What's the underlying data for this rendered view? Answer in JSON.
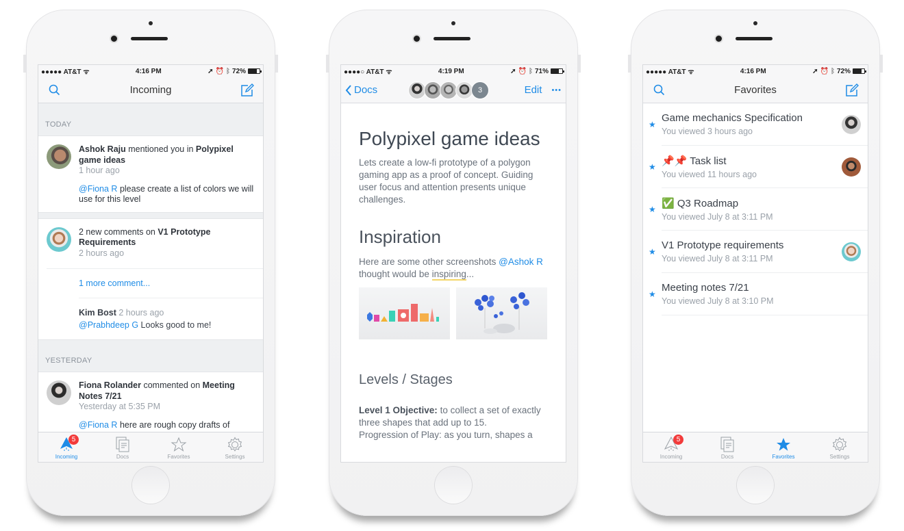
{
  "phones": [
    {
      "status": {
        "carrier": "●●●●● AT&T",
        "time": "4:16 PM",
        "battery": "72%",
        "battery_level": 0.72
      },
      "nav": {
        "title": "Incoming",
        "left_icon": "search-icon",
        "right_icon": "compose-icon"
      },
      "sections": [
        {
          "label": "TODAY"
        },
        {
          "label": "YESTERDAY"
        }
      ],
      "notifications": [
        {
          "actor": "Ashok Raju",
          "verb": " mentioned you in ",
          "doc": "Polypixel game ideas",
          "time": "1 hour ago",
          "mention": "@Fiona R",
          "comment": " please create a list of colors we will use for this level"
        },
        {
          "actor": "",
          "verb": "2 new comments on ",
          "doc": "V1 Prototype Requirements",
          "time": "2 hours ago",
          "more_link": "1 more comment...",
          "reply_author": "Kim Bost",
          "reply_time": "2 hours ago",
          "reply_mention": "@Prabhdeep G",
          "reply_text": " Looks good to me!"
        },
        {
          "actor": "Fiona Rolander",
          "verb": " commented on ",
          "doc": "Meeting Notes 7/21",
          "time": "Yesterday at 5:35 PM",
          "mention": "@Fiona R",
          "comment": " here are rough copy drafts of"
        }
      ],
      "tabs": [
        {
          "label": "Incoming",
          "icon": "incoming-icon",
          "active": true,
          "badge": "5"
        },
        {
          "label": "Docs",
          "icon": "docs-icon",
          "active": false
        },
        {
          "label": "Favorites",
          "icon": "star-icon",
          "active": false
        },
        {
          "label": "Settings",
          "icon": "gear-icon",
          "active": false
        }
      ]
    },
    {
      "status": {
        "carrier": "●●●●○ AT&T",
        "time": "4:19 PM",
        "battery": "71%",
        "battery_level": 0.71
      },
      "nav": {
        "back_label": "Docs",
        "edit_label": "Edit",
        "more_label": "•••",
        "extra_collaborators": "3"
      },
      "doc": {
        "title": "Polypixel game ideas",
        "intro": "Lets create a low-fi prototype of a polygon gaming app as a proof of concept. Guiding user focus and attention presents unique challenges.",
        "section1_title": "Inspiration",
        "section1_text_a": "Here are some other screenshots ",
        "section1_mention": "@Ashok R",
        "section1_text_b": " thought would be ",
        "section1_highlight": "inspiring",
        "section1_text_c": "...",
        "section2_title": "Levels / Stages",
        "level1_label": "Level 1 Objective:",
        "level1_text": " to collect a set of exactly three shapes that add up to 15.",
        "cutoff_text": "Progression of Play: as you turn, shapes a"
      }
    },
    {
      "status": {
        "carrier": "●●●●● AT&T",
        "time": "4:16 PM",
        "battery": "72%",
        "battery_level": 0.72
      },
      "nav": {
        "title": "Favorites",
        "left_icon": "search-icon",
        "right_icon": "compose-icon"
      },
      "favorites": [
        {
          "prefix": "",
          "name": "Game mechanics Specification",
          "sub": "You viewed 3 hours ago",
          "avatar": true
        },
        {
          "prefix": "📌📌 ",
          "name": "Task list",
          "sub": "You viewed 11 hours ago",
          "avatar": true
        },
        {
          "prefix": "✅ ",
          "name": "Q3 Roadmap",
          "sub": "You viewed July 8 at 3:11 PM",
          "avatar": false
        },
        {
          "prefix": "",
          "name": "V1 Prototype requirements",
          "sub": "You viewed July 8 at 3:11 PM",
          "avatar": true
        },
        {
          "prefix": "",
          "name": "Meeting notes 7/21",
          "sub": "You viewed July 8 at 3:10 PM",
          "avatar": false
        }
      ],
      "tabs": [
        {
          "label": "Incoming",
          "icon": "incoming-icon",
          "active": false,
          "badge": "5"
        },
        {
          "label": "Docs",
          "icon": "docs-icon",
          "active": false
        },
        {
          "label": "Favorites",
          "icon": "star-icon",
          "active": true
        },
        {
          "label": "Settings",
          "icon": "gear-icon",
          "active": false
        }
      ]
    }
  ],
  "colors": {
    "accent": "#1f8ce6",
    "badge": "#f23b3b",
    "section_bg": "#eef0f2",
    "highlight": "#f3d567"
  }
}
